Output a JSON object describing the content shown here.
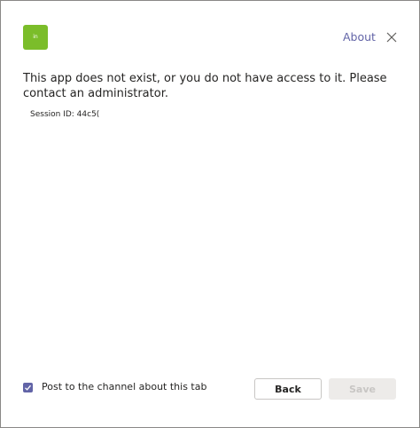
{
  "dialog": {
    "app_icon": {
      "name": "app-logo-icon",
      "glyph": "in",
      "color": "#7bbd2a"
    },
    "about_label": "About",
    "close_icon": "close-icon",
    "accent_color": "#6264a7"
  },
  "content": {
    "message": "This app does not exist, or you do not have access to it. Please contact an administrator.",
    "session_label": "Session ID: 44c5("
  },
  "footer": {
    "checkbox_checked": true,
    "checkbox_label": "Post to the channel about this tab",
    "back_label": "Back",
    "save_label": "Save",
    "save_disabled": true
  }
}
